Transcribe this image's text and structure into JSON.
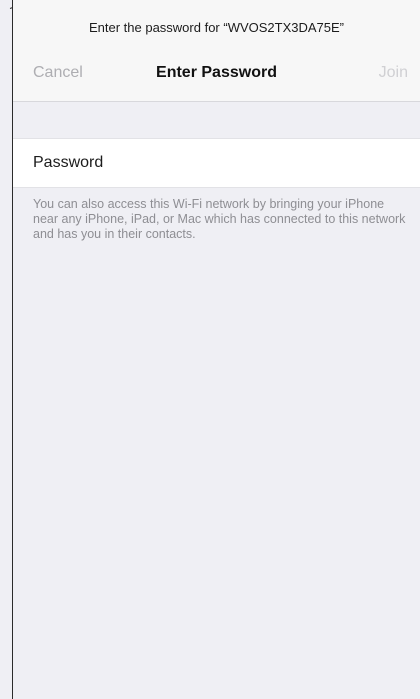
{
  "header": {
    "prompt": "Enter the password for “WVOS2TX3DA75E”",
    "cancel_label": "Cancel",
    "title": "Enter Password",
    "join_label": "Join"
  },
  "form": {
    "password_placeholder": "Password",
    "password_value": ""
  },
  "footnote": "You can also access this Wi-Fi network by bringing your iPhone near any iPhone, iPad, or Mac which has connected to this network and has you in their contacts.",
  "colors": {
    "background": "#efeff4",
    "header_background": "#f7f7f7",
    "disabled_text": "#aeaeb2",
    "footnote_text": "#8e8e93"
  }
}
